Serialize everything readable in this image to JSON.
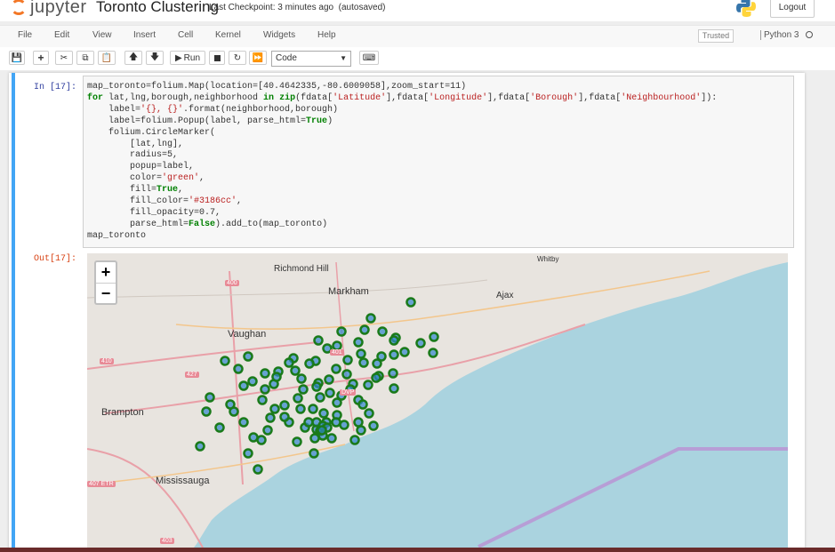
{
  "header": {
    "logo_text": "jupyter",
    "notebook_name": "Toronto Clustering",
    "checkpoint": "Last Checkpoint: 3 minutes ago",
    "autosave": "(autosaved)",
    "logout_label": "Logout"
  },
  "menubar": {
    "items": [
      "File",
      "Edit",
      "View",
      "Insert",
      "Cell",
      "Kernel",
      "Widgets",
      "Help"
    ],
    "trusted": "Trusted",
    "kernel": "Python 3"
  },
  "toolbar": {
    "run_label": "Run",
    "cell_type": "Code"
  },
  "cell": {
    "in_prompt": "In [17]:",
    "out_prompt": "Out[17]:",
    "code_lines": [
      "map_toronto=folium.Map(location=[40.4642335,-80.6009058],zoom_start=11)",
      "for lat,lng,borough,neighborhood in zip(fdata['Latitude'],fdata['Longitude'],fdata['Borough'],fdata['Neighbourhood']):",
      "    label='{}, {}'.format(neighborhood,borough)",
      "    label=folium.Popup(label, parse_html=True)",
      "    folium.CircleMarker(",
      "        [lat,lng],",
      "        radius=5,",
      "        popup=label,",
      "        color='green',",
      "        fill=True,",
      "        fill_color='#3186cc',",
      "        fill_opacity=0.7,",
      "        parse_html=False).add_to(map_toronto)",
      "map_toronto"
    ]
  },
  "map": {
    "zoom_in": "+",
    "zoom_out": "−",
    "labels": [
      "Richmond Hill",
      "Markham",
      "Ajax",
      "Whitby",
      "Vaughan",
      "Brampton",
      "Mississauga"
    ],
    "shields": [
      "400",
      "410",
      "427",
      "401",
      "DVP",
      "407 ETR",
      "403"
    ],
    "marker_color": "#1a7a1a",
    "marker_fill": "#3186cc",
    "water_color": "#aad3df",
    "land_color": "#e8e4df"
  }
}
